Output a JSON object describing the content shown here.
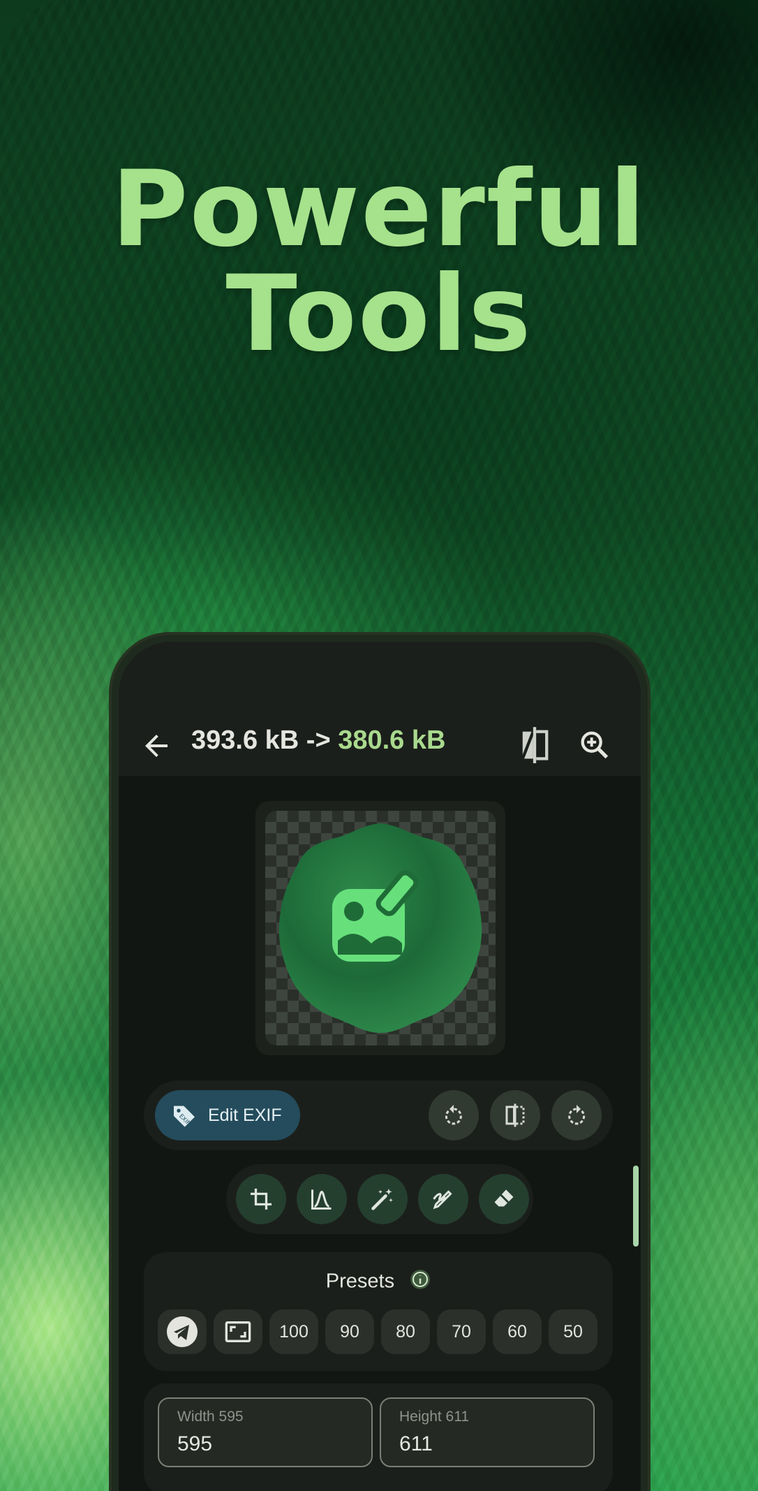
{
  "headline": {
    "line1": "Powerful",
    "line2": "Tools"
  },
  "appbar": {
    "size_before": "393.6 kB",
    "arrow": "->",
    "size_after": "380.6 kB",
    "back_icon": "arrow-back-icon",
    "compare_icon": "compare-icon",
    "zoom_icon": "zoom-in-icon"
  },
  "preview": {
    "icon": "image-edit-icon"
  },
  "actions": {
    "edit_exif_label": "Edit EXIF",
    "edit_exif_icon": "exif-tag-icon",
    "rotate_left_icon": "rotate-left-icon",
    "flip_icon": "flip-icon",
    "rotate_right_icon": "rotate-right-icon"
  },
  "tools": [
    "crop-icon",
    "curves-icon",
    "magic-wand-icon",
    "draw-icon",
    "eraser-icon"
  ],
  "presets": {
    "title": "Presets",
    "info_icon": "info-icon",
    "items": [
      {
        "type": "icon",
        "icon": "telegram-icon",
        "selected": true
      },
      {
        "type": "icon",
        "icon": "aspect-ratio-icon"
      },
      {
        "type": "value",
        "label": "100"
      },
      {
        "type": "value",
        "label": "90"
      },
      {
        "type": "value",
        "label": "80"
      },
      {
        "type": "value",
        "label": "70"
      },
      {
        "type": "value",
        "label": "60"
      },
      {
        "type": "value",
        "label": "50"
      }
    ]
  },
  "size_fields": {
    "width": {
      "label": "Width 595",
      "value": "595"
    },
    "height": {
      "label": "Height 611",
      "value": "611"
    }
  },
  "colors": {
    "accent": "#a9d98e",
    "surface": "#1b1f1b",
    "exif_button": "#244c5c",
    "tool_button": "#253f2f"
  }
}
